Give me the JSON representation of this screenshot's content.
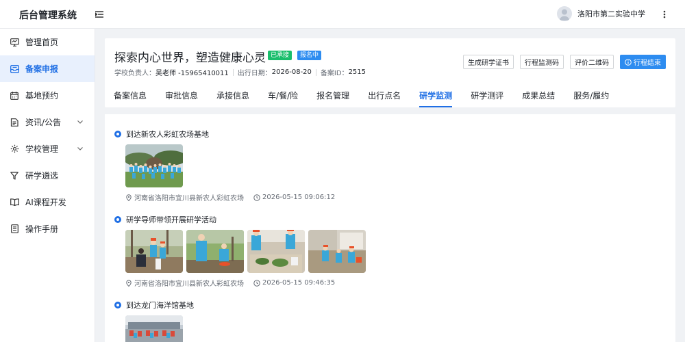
{
  "app": {
    "title": "后台管理系统"
  },
  "user": {
    "name": "洛阳市第二实验中学"
  },
  "sidebar": {
    "items": [
      {
        "label": "管理首页",
        "icon": "monitor-icon"
      },
      {
        "label": "备案申报",
        "icon": "inbox-icon",
        "active": true
      },
      {
        "label": "基地预约",
        "icon": "calendar-icon"
      },
      {
        "label": "资讯/公告",
        "icon": "news-icon",
        "expandable": true
      },
      {
        "label": "学校管理",
        "icon": "settings-icon",
        "expandable": true
      },
      {
        "label": "研学遴选",
        "icon": "filter-icon"
      },
      {
        "label": "AI课程开发",
        "icon": "book-icon"
      },
      {
        "label": "操作手册",
        "icon": "manual-icon"
      }
    ]
  },
  "plan": {
    "title": "探索内心世界，塑造健康心灵",
    "badges": {
      "accepted": "已承接",
      "registering": "报名中"
    },
    "principal_label": "学校负责人：",
    "principal_value": "吴老师 -15965410011",
    "date_label": "出行日期：",
    "date_value": "2026-08-20",
    "id_label": "备案ID：",
    "id_value": "2515"
  },
  "actions": {
    "certificate": "生成研学证书",
    "monitor_code": "行程监测码",
    "qr_code": "评价二维码",
    "end_trip": "行程结束"
  },
  "tabs": [
    {
      "label": "备案信息"
    },
    {
      "label": "审批信息"
    },
    {
      "label": "承接信息"
    },
    {
      "label": "车/餐/险"
    },
    {
      "label": "报名管理"
    },
    {
      "label": "出行点名"
    },
    {
      "label": "研学监测",
      "active": true
    },
    {
      "label": "研学测评"
    },
    {
      "label": "成果总结"
    },
    {
      "label": "服务/履约"
    }
  ],
  "events": [
    {
      "title": "到达新农人彩虹农场基地",
      "location": "河南省洛阳市宜川县新农人彩虹农场",
      "time": "2026-05-15 09:06:12",
      "photo_count": 1
    },
    {
      "title": "研学导师带领开展研学活动",
      "location": "河南省洛阳市宜川县新农人彩虹农场",
      "time": "2026-05-15 09:46:35",
      "photo_count": 4
    },
    {
      "title": "到达龙门海洋馆基地",
      "location": "",
      "time": "",
      "photo_count": 1
    }
  ],
  "colors": {
    "accent": "#1f6fe5",
    "primary_button": "#2d8cf0",
    "badge_green": "#19be6b",
    "badge_blue": "#2d8cf0"
  }
}
